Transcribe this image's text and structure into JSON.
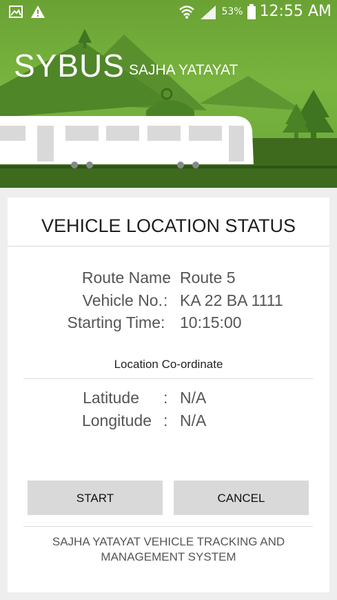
{
  "status_bar": {
    "left_icons": [
      "image-notification-icon",
      "warning-icon"
    ],
    "right_icons": [
      "wifi-icon",
      "signal-icon",
      "battery-icon"
    ],
    "battery_percent": "53%",
    "time": "12:55 AM"
  },
  "header": {
    "app_name": "SYBUS",
    "subtitle": "SAJHA YATAYAT"
  },
  "card": {
    "title": "VEHICLE LOCATION STATUS",
    "details": [
      {
        "label": "Route Name",
        "sep": ":",
        "value": "Route 5"
      },
      {
        "label": "Vehicle No.",
        "sep": ":",
        "value": "KA 22 BA 1111"
      },
      {
        "label": "Starting Time",
        "sep": ":",
        "value": "10:15:00"
      }
    ],
    "location_section": "Location Co-ordinate",
    "coordinates": [
      {
        "label": "Latitude",
        "sep": ":",
        "value": "N/A"
      },
      {
        "label": "Longitude",
        "sep": ":",
        "value": "N/A"
      }
    ],
    "start_button": "START",
    "cancel_button": "CANCEL",
    "footer": "SAJHA YATAYAT VEHICLE TRACKING AND MANAGEMENT SYSTEM"
  },
  "colors": {
    "header_green": "#78b43e",
    "button_gray": "#d9d9d9",
    "background": "#eeeeee"
  }
}
